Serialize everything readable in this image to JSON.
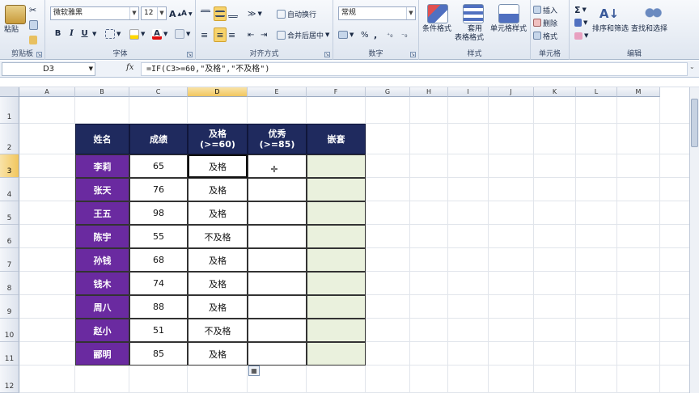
{
  "ribbon": {
    "clipboard": {
      "paste_label": "粘贴",
      "group_label": "剪贴板"
    },
    "font": {
      "font_name": "微软雅黑",
      "font_size": "12",
      "bold": "B",
      "italic": "I",
      "underline": "U",
      "group_label": "字体"
    },
    "alignment": {
      "wrap_label": "自动换行",
      "merge_label": "合并后居中",
      "group_label": "对齐方式"
    },
    "number": {
      "format_value": "常规",
      "percent": "%",
      "comma": ",",
      "group_label": "数字"
    },
    "styles": {
      "conditional_label": "条件格式",
      "table_label_1": "套用",
      "table_label_2": "表格格式",
      "cell_style_label": "单元格样式",
      "group_label": "样式"
    },
    "cells": {
      "insert_label": "插入",
      "delete_label": "删除",
      "format_label": "格式",
      "group_label": "单元格"
    },
    "editing": {
      "sigma": "Σ",
      "sort_label": "排序和筛选",
      "find_label": "查找和选择",
      "group_label": "编辑"
    }
  },
  "formula_bar": {
    "name_box": "D3",
    "fx": "fx",
    "formula": "=IF(C3>=60,\"及格\",\"不及格\")"
  },
  "columns": [
    "A",
    "B",
    "C",
    "D",
    "E",
    "F",
    "G",
    "H",
    "I",
    "J",
    "K",
    "L",
    "M"
  ],
  "rows": [
    "1",
    "2",
    "3",
    "4",
    "5",
    "6",
    "7",
    "8",
    "9",
    "10",
    "11",
    "12"
  ],
  "table": {
    "headers": [
      {
        "line1": "姓名",
        "line2": ""
      },
      {
        "line1": "成绩",
        "line2": ""
      },
      {
        "line1": "及格",
        "line2": "(>=60)"
      },
      {
        "line1": "优秀",
        "line2": "(>=85)"
      },
      {
        "line1": "嵌套",
        "line2": ""
      }
    ],
    "rows": [
      {
        "name": "李莉",
        "score": "65",
        "pass": "及格"
      },
      {
        "name": "张天",
        "score": "76",
        "pass": "及格"
      },
      {
        "name": "王五",
        "score": "98",
        "pass": "及格"
      },
      {
        "name": "陈宇",
        "score": "55",
        "pass": "不及格"
      },
      {
        "name": "孙钱",
        "score": "68",
        "pass": "及格"
      },
      {
        "name": "钱木",
        "score": "74",
        "pass": "及格"
      },
      {
        "name": "周八",
        "score": "88",
        "pass": "及格"
      },
      {
        "name": "赵小",
        "score": "51",
        "pass": "不及格"
      },
      {
        "name": "郦明",
        "score": "85",
        "pass": "及格"
      }
    ]
  },
  "colors": {
    "header_bg": "#1f2a5e",
    "name_bg": "#6a2aa0",
    "nested_bg": "#eaf1dd",
    "active_header": "#f1c65e"
  }
}
